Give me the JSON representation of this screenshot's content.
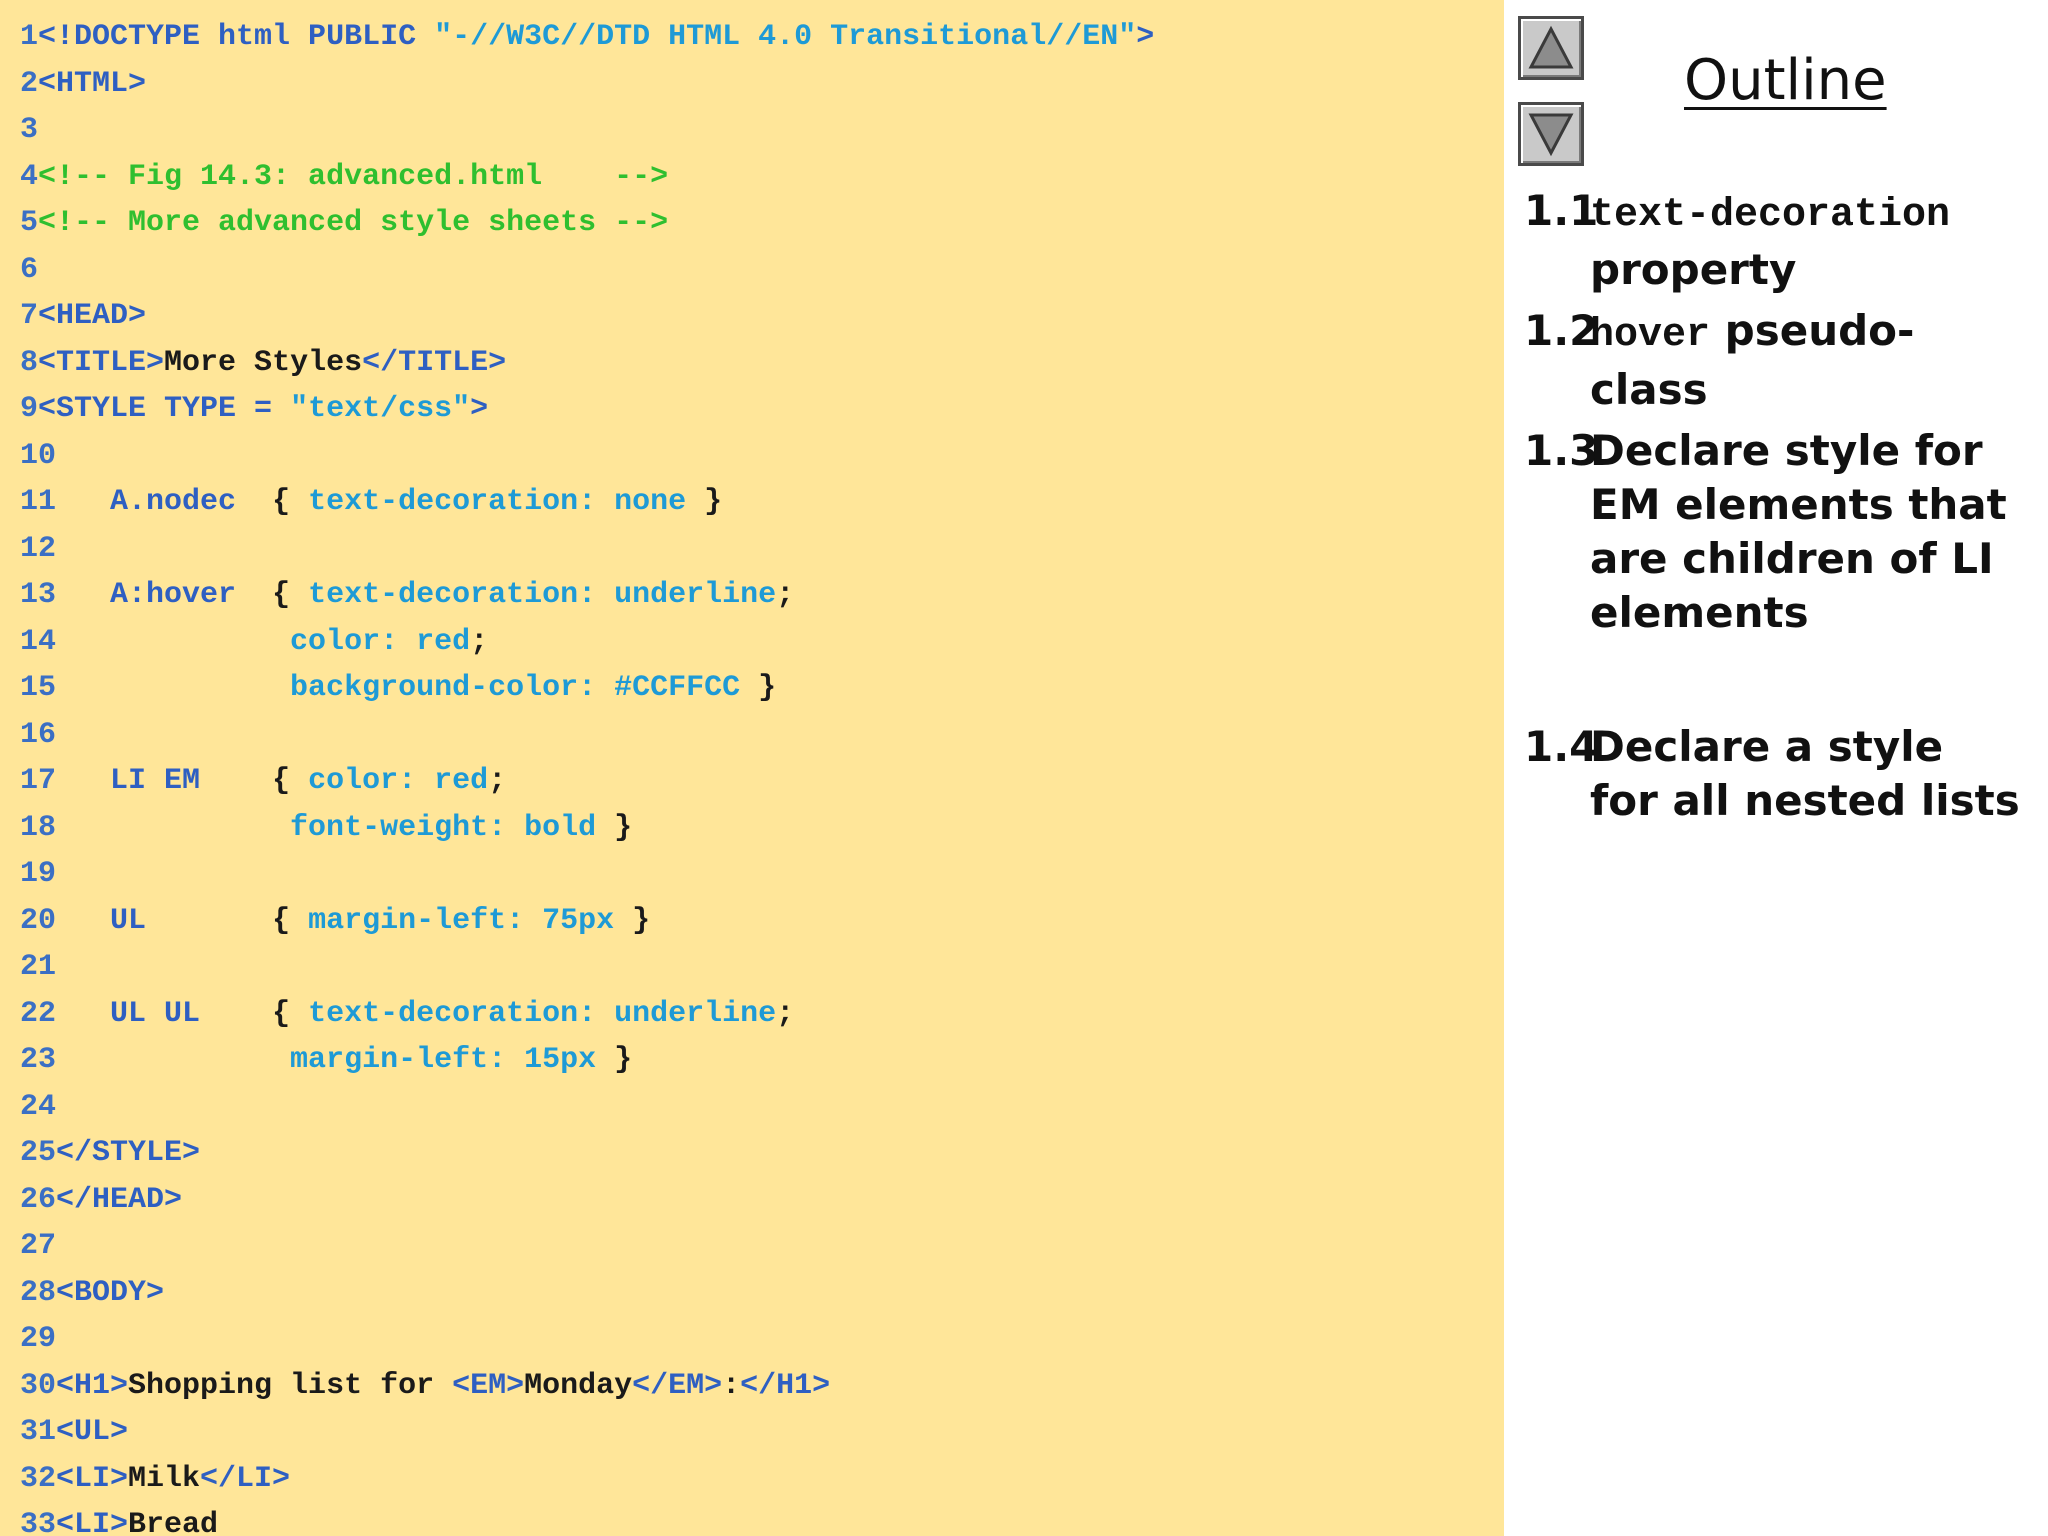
{
  "code_lines": [
    {
      "num": "1",
      "parts": [
        [
          "tag",
          "<!DOCTYPE html PUBLIC "
        ],
        [
          "str",
          "\"-//W3C//DTD HTML 4.0 Transitional//EN\""
        ],
        [
          "tag",
          ">"
        ]
      ]
    },
    {
      "num": "2",
      "parts": [
        [
          "tag",
          "<HTML>"
        ]
      ]
    },
    {
      "num": "3",
      "parts": []
    },
    {
      "num": "4",
      "parts": [
        [
          "cmt",
          "<!-- Fig 14.3: advanced.html    -->"
        ]
      ]
    },
    {
      "num": "5",
      "parts": [
        [
          "cmt",
          "<!-- More advanced style sheets -->"
        ]
      ]
    },
    {
      "num": "6",
      "parts": []
    },
    {
      "num": "7",
      "parts": [
        [
          "tag",
          "<HEAD>"
        ]
      ]
    },
    {
      "num": "8",
      "parts": [
        [
          "tag",
          "<TITLE>"
        ],
        [
          "txt",
          "More Styles"
        ],
        [
          "tag",
          "</TITLE>"
        ]
      ]
    },
    {
      "num": "9",
      "parts": [
        [
          "tag",
          "<STYLE TYPE = "
        ],
        [
          "str",
          "\"text/css\""
        ],
        [
          "tag",
          ">"
        ]
      ]
    },
    {
      "num": "10",
      "parts": []
    },
    {
      "num": "11",
      "parts": [
        [
          "tag",
          "   A.nodec  "
        ],
        [
          "txt",
          "{ "
        ],
        [
          "css",
          "text-decoration: none"
        ],
        [
          "txt",
          " }"
        ]
      ]
    },
    {
      "num": "12",
      "parts": []
    },
    {
      "num": "13",
      "parts": [
        [
          "tag",
          "   A:hover  "
        ],
        [
          "txt",
          "{ "
        ],
        [
          "css",
          "text-decoration: underline"
        ],
        [
          "txt",
          ";"
        ]
      ]
    },
    {
      "num": "14",
      "parts": [
        [
          "css",
          "             color: red"
        ],
        [
          "txt",
          ";"
        ]
      ]
    },
    {
      "num": "15",
      "parts": [
        [
          "css",
          "             background-color: #CCFFCC"
        ],
        [
          "txt",
          " }"
        ]
      ]
    },
    {
      "num": "16",
      "parts": []
    },
    {
      "num": "17",
      "parts": [
        [
          "tag",
          "   LI EM    "
        ],
        [
          "txt",
          "{ "
        ],
        [
          "css",
          "color: red"
        ],
        [
          "txt",
          ";"
        ]
      ]
    },
    {
      "num": "18",
      "parts": [
        [
          "css",
          "             font-weight: bold"
        ],
        [
          "txt",
          " }"
        ]
      ]
    },
    {
      "num": "19",
      "parts": []
    },
    {
      "num": "20",
      "parts": [
        [
          "tag",
          "   UL       "
        ],
        [
          "txt",
          "{ "
        ],
        [
          "css",
          "margin-left: 75px"
        ],
        [
          "txt",
          " }"
        ]
      ]
    },
    {
      "num": "21",
      "parts": []
    },
    {
      "num": "22",
      "parts": [
        [
          "tag",
          "   UL UL    "
        ],
        [
          "txt",
          "{ "
        ],
        [
          "css",
          "text-decoration: underline"
        ],
        [
          "txt",
          ";"
        ]
      ]
    },
    {
      "num": "23",
      "parts": [
        [
          "css",
          "             margin-left: 15px"
        ],
        [
          "txt",
          " }"
        ]
      ]
    },
    {
      "num": "24",
      "parts": []
    },
    {
      "num": "25",
      "parts": [
        [
          "tag",
          "</STYLE>"
        ]
      ]
    },
    {
      "num": "26",
      "parts": [
        [
          "tag",
          "</HEAD>"
        ]
      ]
    },
    {
      "num": "27",
      "parts": []
    },
    {
      "num": "28",
      "parts": [
        [
          "tag",
          "<BODY>"
        ]
      ]
    },
    {
      "num": "29",
      "parts": []
    },
    {
      "num": "30",
      "parts": [
        [
          "tag",
          "<H1>"
        ],
        [
          "txt",
          "Shopping list for "
        ],
        [
          "tag",
          "<EM>"
        ],
        [
          "txt",
          "Monday"
        ],
        [
          "tag",
          "</EM>"
        ],
        [
          "txt",
          ":"
        ],
        [
          "tag",
          "</H1>"
        ]
      ]
    },
    {
      "num": "31",
      "parts": [
        [
          "tag",
          "<UL>"
        ]
      ]
    },
    {
      "num": "32",
      "parts": [
        [
          "tag",
          "<LI>"
        ],
        [
          "txt",
          "Milk"
        ],
        [
          "tag",
          "</LI>"
        ]
      ]
    },
    {
      "num": "33",
      "parts": [
        [
          "tag",
          "<LI>"
        ],
        [
          "txt",
          "Bread"
        ]
      ]
    }
  ],
  "nav": {
    "up_icon": "triangle-up-icon",
    "down_icon": "triangle-down-icon"
  },
  "outline": {
    "title": "Outline",
    "items": [
      {
        "num": "1.1",
        "code": "text-decoration",
        "text": " property"
      },
      {
        "num": "1.2",
        "code": "hover",
        "text": " pseudo-class"
      },
      {
        "num": "1.3",
        "code": "",
        "text": "Declare style for EM elements that are children of LI elements"
      },
      {
        "num": "1.4",
        "code": "",
        "text": "Declare a style for all nested lists"
      }
    ]
  },
  "colors": {
    "code_background": "#ffe699",
    "tag": "#2e5fc2",
    "string": "#1e9ad6",
    "comment": "#2fbf2f",
    "text": "#1a1a1a"
  }
}
